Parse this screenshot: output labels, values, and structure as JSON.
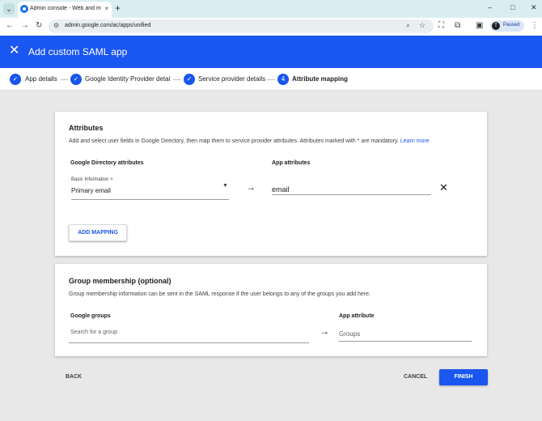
{
  "browser": {
    "tab_title": "Admin console - Web and mobile apps",
    "tab_close": "×",
    "new_tab": "+",
    "url": "admin.google.com/ac/apps/unified",
    "profile_initial": "T",
    "profile_status": "Paused",
    "window_controls": {
      "minimize": "–",
      "maximize": "□",
      "close": "✕"
    }
  },
  "header": {
    "close_icon": "✕",
    "title": "Add custom SAML app"
  },
  "stepper": {
    "steps": [
      {
        "label": "App details",
        "state": "done",
        "marker": "✓"
      },
      {
        "label": "Google Identity Provider details",
        "state": "done",
        "marker": "✓"
      },
      {
        "label": "Service provider details",
        "state": "done",
        "marker": "✓"
      },
      {
        "label": "Attribute mapping",
        "state": "active",
        "marker": "4"
      }
    ]
  },
  "attributes": {
    "title": "Attributes",
    "description": "Add and select user fields in Google Directory, then map them to service provider attributes. Attributes marked with * are mandatory.",
    "learn_more": "Learn more",
    "col_directory": "Google Directory attributes",
    "col_app": "App attributes",
    "mapping": {
      "category": "Basic Information >",
      "field": "Primary email",
      "app_attribute": "email"
    },
    "arrow": "→",
    "remove_icon": "✕",
    "add_mapping": "ADD MAPPING"
  },
  "group_membership": {
    "title": "Group membership (optional)",
    "description": "Group membership information can be sent in the SAML response if the user belongs to any of the groups you add here.",
    "col_groups": "Google groups",
    "col_app": "App attribute",
    "groups_placeholder": "Search for a group",
    "app_attribute_placeholder": "Groups",
    "arrow": "→"
  },
  "footer": {
    "back": "BACK",
    "cancel": "CANCEL",
    "finish": "FINISH"
  },
  "colors": {
    "brand_blue": "#1a56f0",
    "page_bg": "#e8e8e8",
    "tabbar_bg": "#d9eef0"
  }
}
